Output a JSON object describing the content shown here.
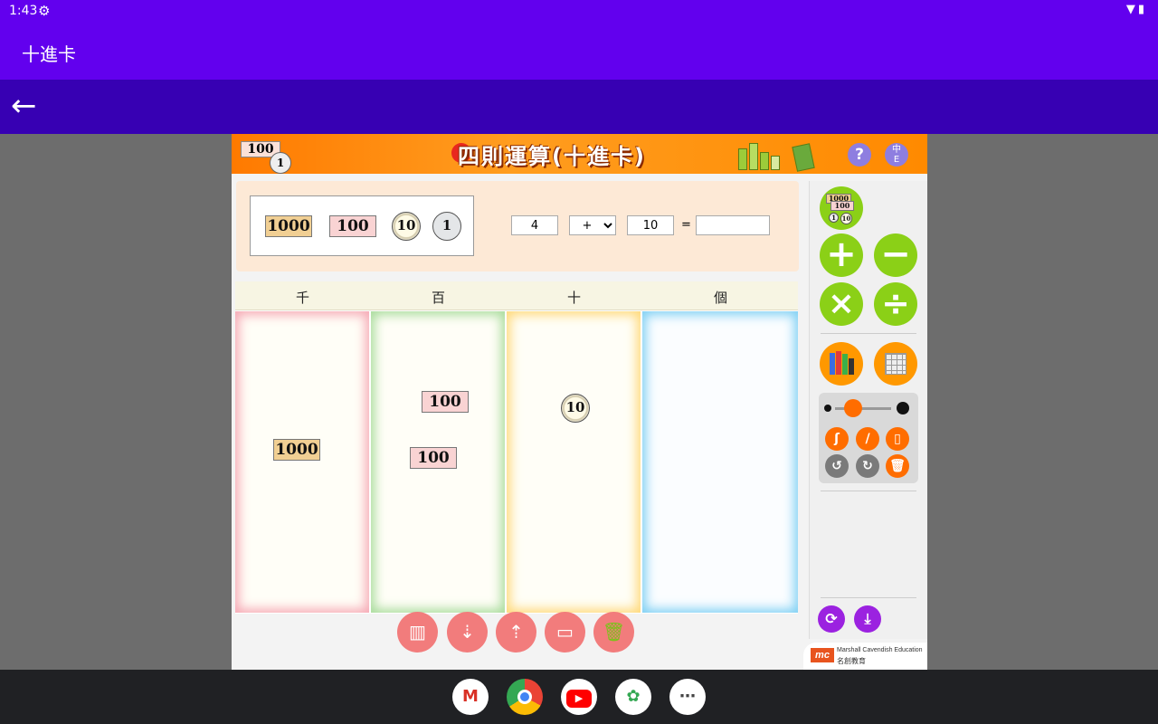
{
  "status": {
    "time": "1:43",
    "settings_icon": "gear-icon",
    "right_icons": [
      "wifi-icon",
      "battery-icon"
    ]
  },
  "appbar": {
    "title": "十進卡"
  },
  "navbar": {
    "back_icon": "arrow-left-icon"
  },
  "banner": {
    "title": "四則運算(十進卡)",
    "logo_note": "100",
    "logo_coin": "1",
    "help_label": "?",
    "lang_top": "中",
    "lang_bottom": "E"
  },
  "palette": {
    "items": [
      "1000",
      "100",
      "10",
      "1"
    ]
  },
  "equation": {
    "operand1": "4",
    "operator": "+",
    "operand2": "10",
    "equals": "=",
    "result": ""
  },
  "board": {
    "columns": [
      "千",
      "百",
      "十",
      "個"
    ],
    "pieces": {
      "thousand": "1000",
      "hundred_a": "100",
      "hundred_b": "100",
      "ten": "10"
    }
  },
  "bottom_tools": [
    "columns-icon",
    "break-down-icon",
    "combine-icon",
    "stack-icon",
    "trash-icon"
  ],
  "sidebar": {
    "ops": [
      "+",
      "−",
      "×",
      "÷"
    ],
    "mini_cards": {
      "a": "1000",
      "b": "100",
      "c": "1",
      "d": "10"
    },
    "pen_tools": [
      "pencil-icon",
      "grid-icon"
    ],
    "tool_row1": [
      "curve-icon",
      "line-icon",
      "eraser-icon"
    ],
    "tool_row2": [
      "undo-icon",
      "redo-icon",
      "trash-icon"
    ],
    "bottom": [
      "refresh-icon",
      "download-icon"
    ]
  },
  "footer": {
    "brand_en": "Marshall Cavendish Education",
    "brand_zh": "名創教育",
    "mark": "mc"
  },
  "dock": [
    "M",
    "C",
    "▶",
    "✿",
    "⋯"
  ]
}
